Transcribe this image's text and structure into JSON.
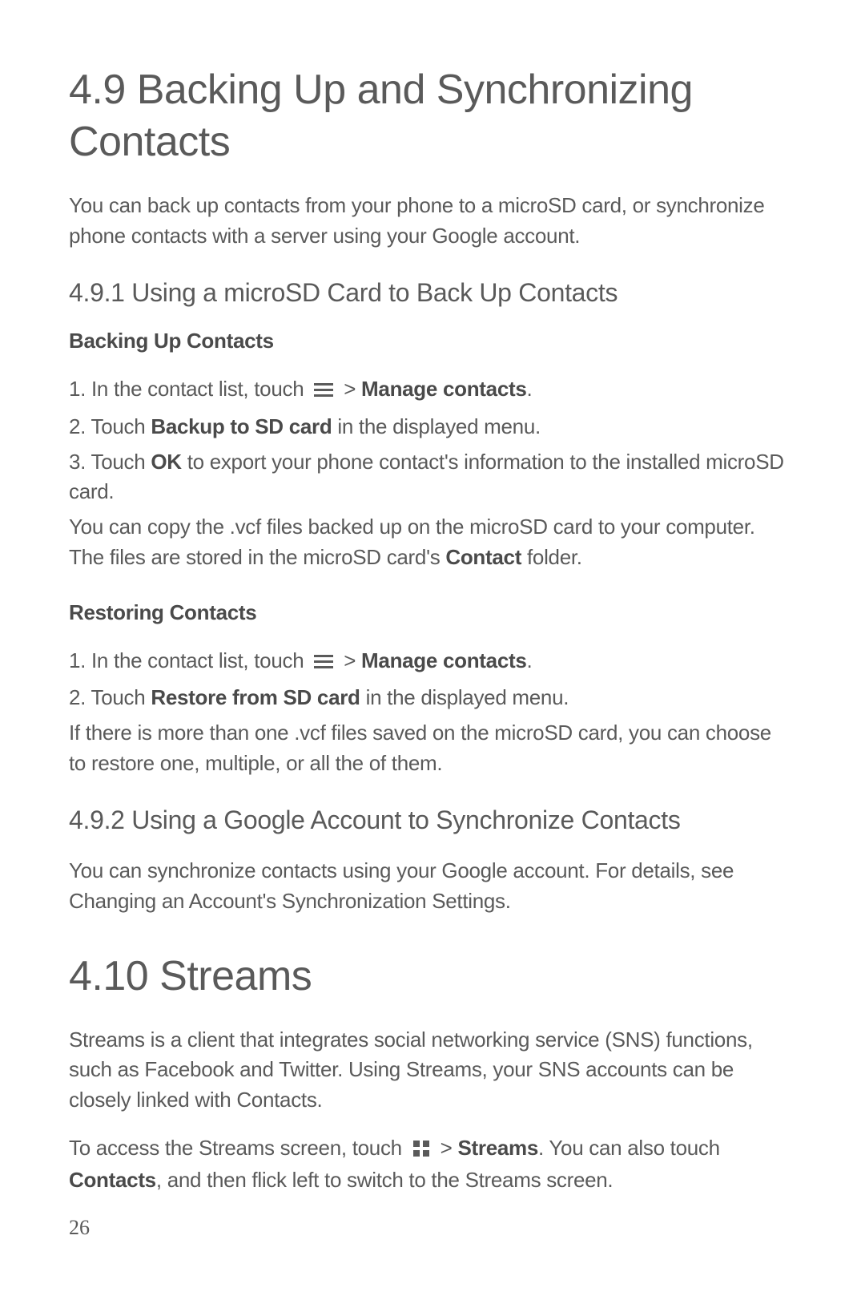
{
  "section49": {
    "title": "4.9  Backing Up and Synchronizing Contacts",
    "intro": "You can back up contacts from your phone to a microSD card, or synchronize phone contacts with a server using your Google account.",
    "s491": {
      "heading": "4.9.1  Using a microSD Card to Back Up Contacts",
      "backup_heading": "Backing Up Contacts",
      "step1_pre": "1. In the contact list, touch ",
      "step1_mid": " > ",
      "step1_bold": "Manage contacts",
      "step1_end": ".",
      "step2_pre": "2. Touch ",
      "step2_bold": "Backup to SD card",
      "step2_end": " in the displayed menu.",
      "step3_pre": "3. Touch ",
      "step3_bold": "OK",
      "step3_end": " to export your phone contact's information to the installed microSD card.",
      "note_pre": "You can copy the .vcf files backed up on the microSD card to your computer. The files are stored in the microSD card's ",
      "note_bold": "Contact",
      "note_end": " folder.",
      "restore_heading": "Restoring Contacts",
      "rstep1_pre": "1. In the contact list, touch ",
      "rstep1_mid": " > ",
      "rstep1_bold": "Manage contacts",
      "rstep1_end": ".",
      "rstep2_pre": "2. Touch ",
      "rstep2_bold": "Restore from SD card",
      "rstep2_end": " in the displayed menu.",
      "rnote": "If there is more than one .vcf files saved on the microSD card, you can choose to restore one, multiple, or all the of them."
    },
    "s492": {
      "heading": "4.9.2  Using a Google Account to Synchronize Contacts",
      "body": "You can synchronize contacts using your Google account. For details, see Changing an Account's Synchronization Settings."
    }
  },
  "section410": {
    "title": "4.10  Streams",
    "intro": "Streams is a client that integrates social networking service (SNS) functions, such as Facebook and Twitter. Using Streams, your SNS accounts can be closely linked with Contacts.",
    "access_pre": "To access the Streams screen, touch ",
    "access_mid": " > ",
    "access_bold": "Streams",
    "access_after": ". You can also touch ",
    "access_bold2": "Contacts",
    "access_end": ", and then flick left to switch to the Streams screen."
  },
  "page_number": "26"
}
